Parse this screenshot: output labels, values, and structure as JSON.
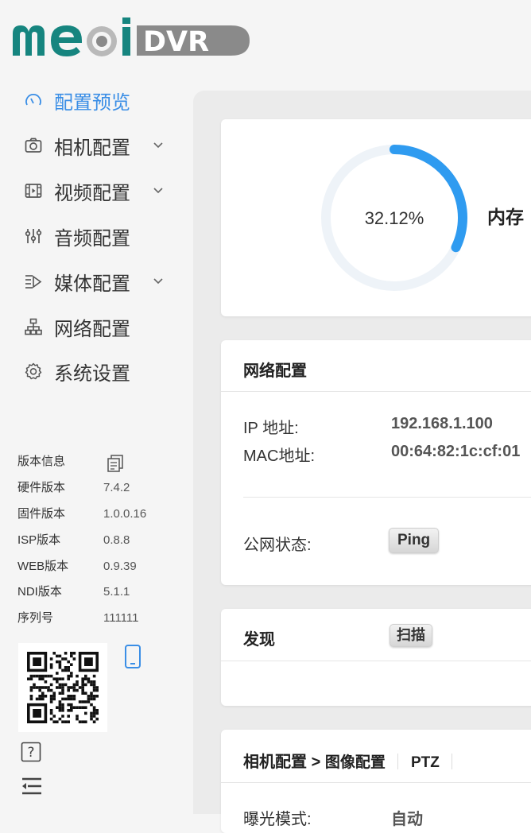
{
  "logo": {
    "main": "meoi",
    "badge": "DVR"
  },
  "nav": [
    {
      "label": "配置预览",
      "icon": "dashboard-icon",
      "active": true,
      "expandable": false
    },
    {
      "label": "相机配置",
      "icon": "camera-icon",
      "active": false,
      "expandable": true
    },
    {
      "label": "视频配置",
      "icon": "film-icon",
      "active": false,
      "expandable": true
    },
    {
      "label": "音频配置",
      "icon": "mixer-icon",
      "active": false,
      "expandable": false
    },
    {
      "label": "媒体配置",
      "icon": "media-icon",
      "active": false,
      "expandable": true
    },
    {
      "label": "网络配置",
      "icon": "network-icon",
      "active": false,
      "expandable": false
    },
    {
      "label": "系统设置",
      "icon": "gear-icon",
      "active": false,
      "expandable": false
    }
  ],
  "version": {
    "title": "版本信息",
    "rows": [
      {
        "key": "硬件版本",
        "value": "7.4.2"
      },
      {
        "key": "固件版本",
        "value": "1.0.0.16"
      },
      {
        "key": "ISP版本",
        "value": "0.8.8"
      },
      {
        "key": "WEB版本",
        "value": "0.9.39"
      },
      {
        "key": "NDI版本",
        "value": "5.1.1"
      },
      {
        "key": "序列号",
        "value": "111111"
      }
    ]
  },
  "memory": {
    "percent_label": "32.12%",
    "fraction": 0.3212,
    "label": "内存",
    "accent": "#2f9bf0"
  },
  "network": {
    "title": "网络配置",
    "ip_label": "IP 地址:",
    "ip_value": "192.168.1.100",
    "mac_label": "MAC地址:",
    "mac_value": "00:64:82:1c:cf:01",
    "public_label": "公网状态:",
    "ping_label": "Ping"
  },
  "discover": {
    "title": "发现",
    "scan_label": "扫描"
  },
  "camera": {
    "crumb_main": "相机配置",
    "crumb_sep": ">",
    "crumb_sub": "图像配置",
    "tab_ptz": "PTZ",
    "exposure_label": "曝光模式:",
    "exposure_value": "自动"
  }
}
